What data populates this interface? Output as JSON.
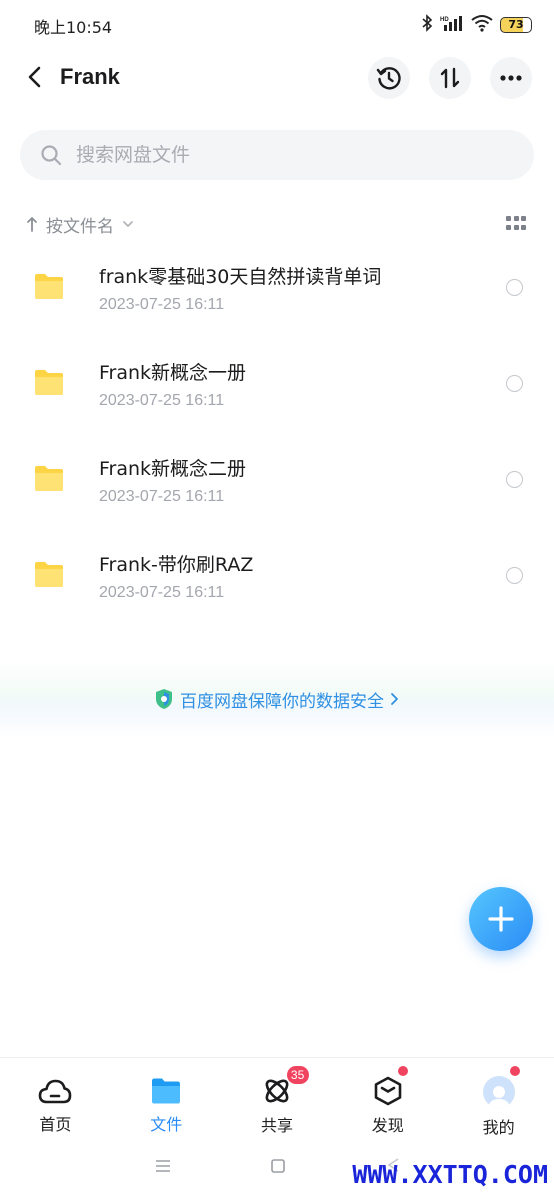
{
  "status": {
    "time": "晚上10:54",
    "battery": "73",
    "icons": [
      "bluetooth-icon",
      "hd-signal-icon",
      "wifi-icon",
      "battery-icon"
    ]
  },
  "header": {
    "title": "Frank",
    "actions": [
      "history-icon",
      "transfer-icon",
      "more-icon"
    ]
  },
  "search": {
    "placeholder": "搜索网盘文件"
  },
  "sort": {
    "label": "按文件名"
  },
  "files": [
    {
      "name": "frank零基础30天自然拼读背单词",
      "date": "2023-07-25  16:11"
    },
    {
      "name": "Frank新概念一册",
      "date": "2023-07-25  16:11"
    },
    {
      "name": "Frank新概念二册",
      "date": "2023-07-25  16:11"
    },
    {
      "name": "Frank-带你刷RAZ",
      "date": "2023-07-25  16:11"
    }
  ],
  "security": {
    "text": "百度网盘保障你的数据安全"
  },
  "nav": {
    "items": [
      {
        "label": "首页",
        "icon": "cloud-icon"
      },
      {
        "label": "文件",
        "icon": "folder-icon"
      },
      {
        "label": "共享",
        "icon": "share-atom-icon",
        "badge": "35"
      },
      {
        "label": "发现",
        "icon": "cube-icon"
      },
      {
        "label": "我的",
        "icon": "avatar-icon"
      }
    ],
    "active_color": "#2a8cf5",
    "badge_color": "#f0435f"
  },
  "watermark": "WWW.XXTTQ.COM",
  "colors": {
    "accent": "#2a8cf5",
    "folder": "#fdd446",
    "secure": "#2f8fe3"
  }
}
